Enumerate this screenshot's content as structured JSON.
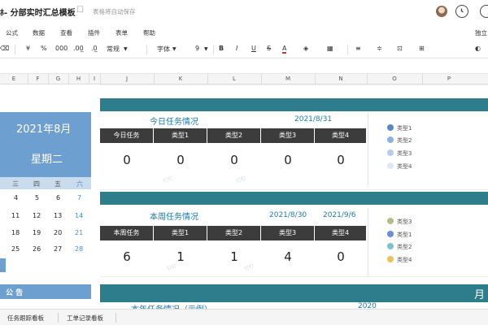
{
  "window": {
    "title": "ﾎ- 分部实时汇总模板",
    "autosave": "表格将自动保存"
  },
  "menu": [
    "公式",
    "数据",
    "查看",
    "插件",
    "表单",
    "帮助",
    "独立"
  ],
  "toolbar": {
    "currency": "¥",
    "percent": "%",
    "thousands": "000",
    "dec_decrease": ".00̲",
    "dec_increase": ".0̲",
    "number_format": "常规",
    "font": "字体",
    "size": "9",
    "bold": "B",
    "italic": "I",
    "underline": "U",
    "strike": "S",
    "font_color": "A"
  },
  "columns": [
    "E",
    "F",
    "G",
    "H",
    "I",
    "J",
    "K",
    "L",
    "M",
    "N",
    "O",
    "P"
  ],
  "calendar": {
    "year_month": "2021年8月",
    "weekday": "星期二",
    "week_headers": [
      "三",
      "四",
      "五",
      "六"
    ],
    "rows": [
      [
        "4",
        "5",
        "6",
        "7"
      ],
      [
        "11",
        "12",
        "13",
        "14"
      ],
      [
        "18",
        "19",
        "20",
        "21"
      ],
      [
        "25",
        "26",
        "27",
        "28"
      ]
    ]
  },
  "notice": "公 告",
  "today": {
    "title": "今日任务情况",
    "date": "2021/8/31",
    "headers": [
      "今日任务",
      "类型1",
      "类型2",
      "类型3",
      "类型4"
    ],
    "values": [
      "0",
      "0",
      "0",
      "0",
      "0"
    ],
    "legend": [
      "类型1",
      "类型2",
      "类型3",
      "类型4"
    ],
    "legend_colors": [
      "#5b87c8",
      "#8eb0dc",
      "#b7cdea",
      "#dde7f4"
    ]
  },
  "week": {
    "title": "本周任务情况",
    "date_start": "2021/8/30",
    "date_end": "2021/9/6",
    "headers": [
      "本周任务",
      "类型1",
      "类型2",
      "类型3",
      "类型4"
    ],
    "values": [
      "6",
      "1",
      "1",
      "4",
      "0"
    ],
    "legend": [
      "类型3",
      "类型1",
      "类型2",
      "类型4"
    ],
    "legend_colors": [
      "#b9bb85",
      "#6a8fd4",
      "#7ec3c8",
      "#f0c05a"
    ]
  },
  "year": {
    "title": "本年任务情况（示例）",
    "date": "2020",
    "side_label": "月"
  },
  "watermark": "钉钉",
  "sheet_tabs": [
    "任务跟踪看板",
    "工单记录看板"
  ]
}
